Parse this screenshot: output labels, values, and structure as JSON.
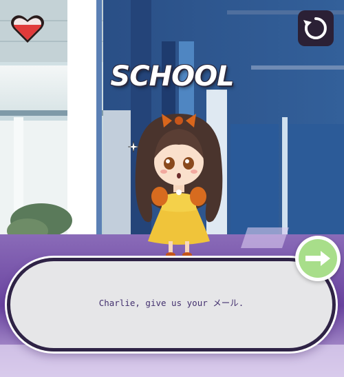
{
  "scene": {
    "location_title": "SCHOOL"
  },
  "dialog": {
    "text": "Charlie, give us your メール."
  },
  "hud": {
    "health_icon": "heart-icon",
    "restart_icon": "restart-icon",
    "next_icon": "arrow-right-icon"
  },
  "colors": {
    "heart": "#e03a3a",
    "dialog_border": "#2f2346",
    "dialog_text": "#43306e",
    "next_button": "#a8de8a"
  }
}
